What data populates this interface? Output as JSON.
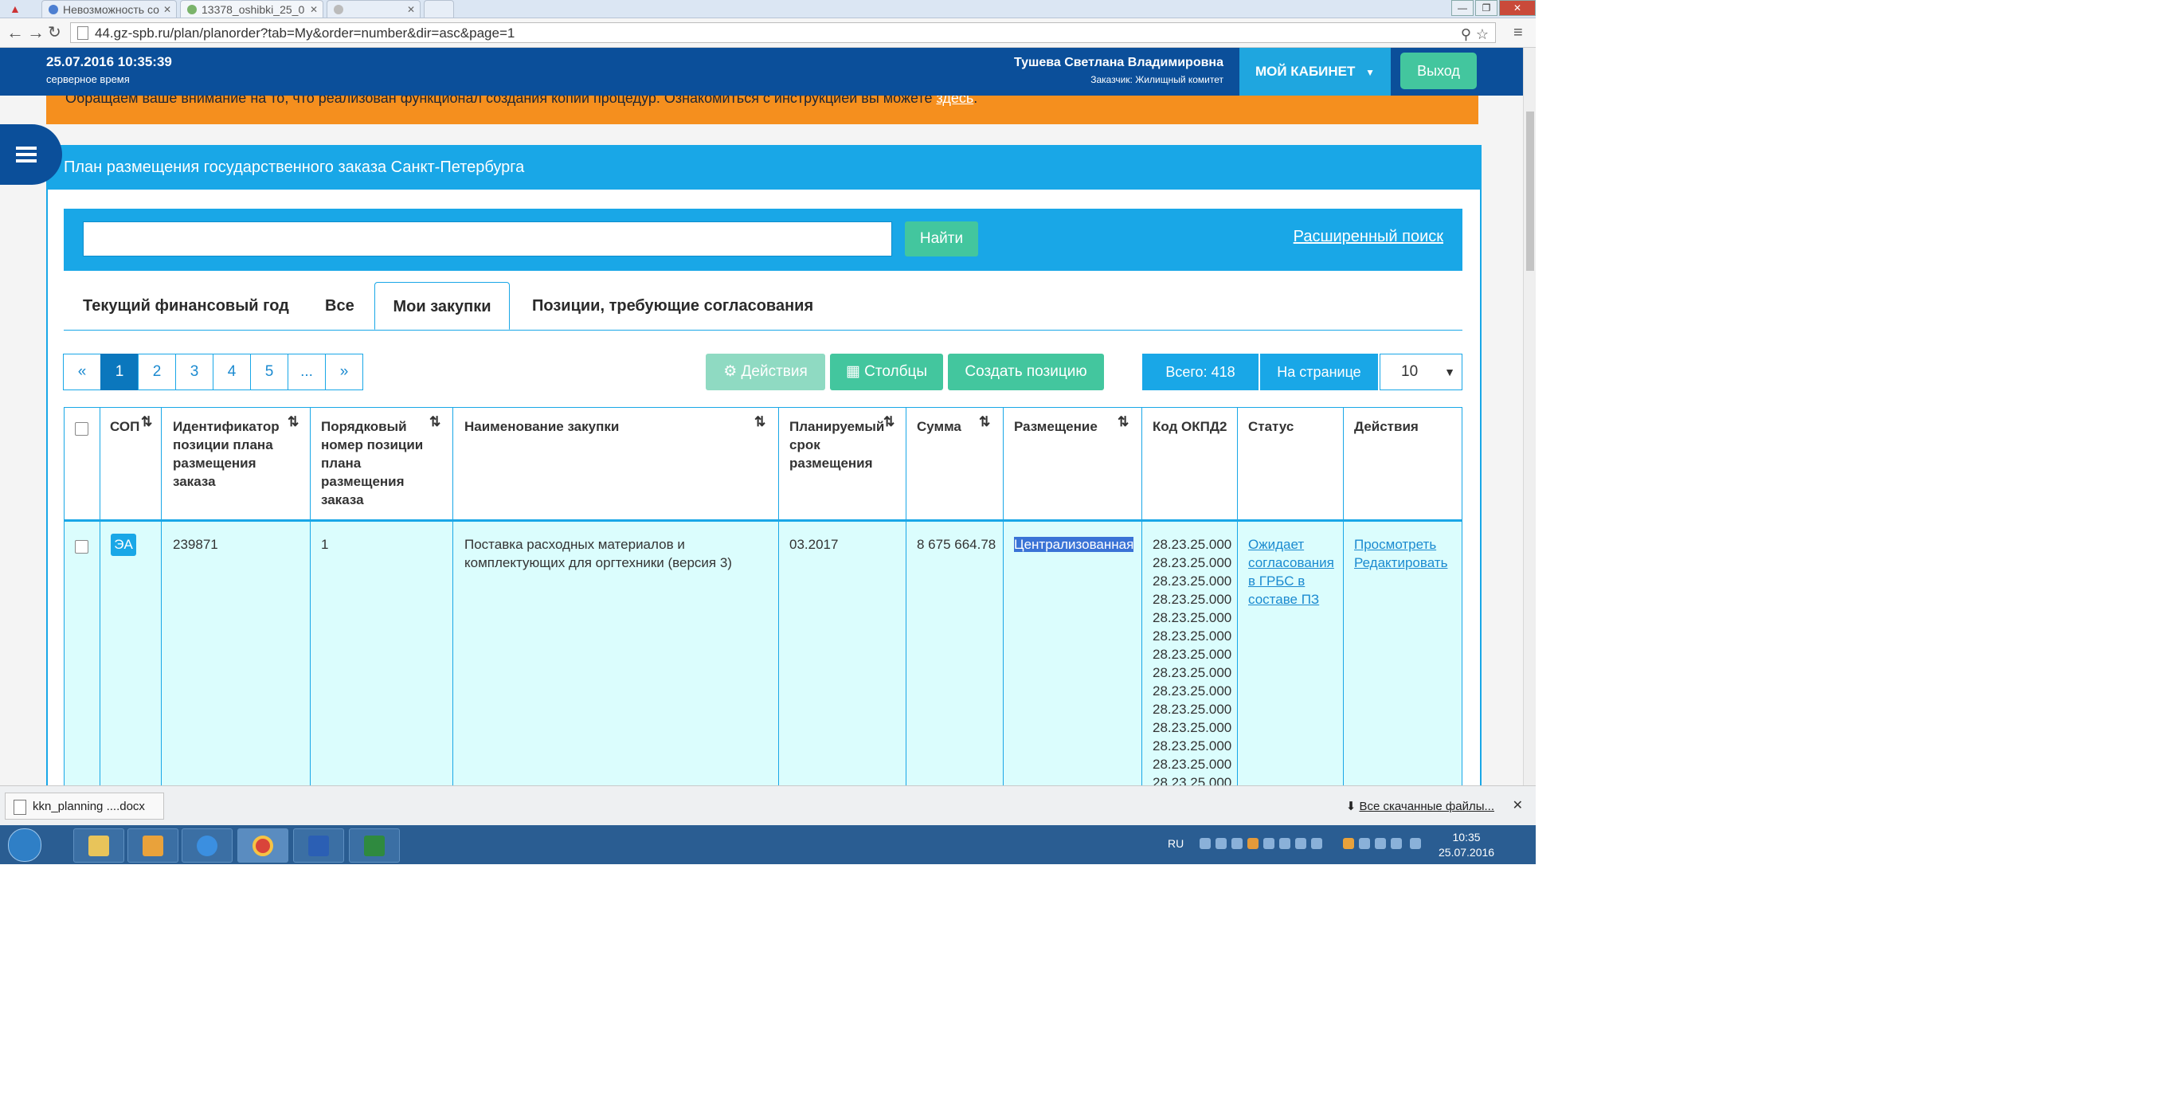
{
  "browser": {
    "tabs": [
      {
        "label": "Невозможность со"
      },
      {
        "label": "13378_oshibki_25_0"
      },
      {
        "label": ""
      }
    ],
    "url": "44.gz-spb.ru/plan/planorder?tab=My&order=number&dir=asc&page=1"
  },
  "header": {
    "server_time": "25.07.2016 10:35:39",
    "server_time_label": "серверное время",
    "user_name": "Тушева Светлана Владимировна",
    "customer": "Заказчик: Жилищный комитет",
    "cabinet_label": "МОЙ КАБИНЕТ",
    "logout_label": "Выход"
  },
  "notice": {
    "text": "Обращаем ваше внимание на то, что реализован функционал создания копии процедур. Ознакомиться с инструкцией вы можете ",
    "link": "здесь",
    "tail": "."
  },
  "panel": {
    "title": "План размещения государственного заказа Санкт-Петербурга"
  },
  "search": {
    "value": "",
    "button": "Найти",
    "advanced": "Расширенный поиск"
  },
  "tabs": [
    {
      "label": "Текущий финансовый год"
    },
    {
      "label": "Все"
    },
    {
      "label": "Мои закупки"
    },
    {
      "label": "Позиции, требующие согласования"
    }
  ],
  "pager": [
    "«",
    "1",
    "2",
    "3",
    "4",
    "5",
    "...",
    "»"
  ],
  "toolbar": {
    "actions": "Действия",
    "columns": "Столбцы",
    "create": "Создать позицию",
    "total": "Всего: 418",
    "per_page_label": "На странице",
    "per_page_value": "10"
  },
  "table": {
    "headers": {
      "sop": "СОП",
      "id": "Идентификатор позиции плана размещения заказа",
      "order_num": "Порядковый номер позиции плана размещения заказа",
      "name": "Наименование закупки",
      "term": "Планируемый срок размещения",
      "sum": "Сумма",
      "placement": "Размещение",
      "okpd": "Код ОКПД2",
      "status": "Статус",
      "actions": "Действия"
    },
    "rows": [
      {
        "sop": "ЭА",
        "id": "239871",
        "order_num": "1",
        "name": "Поставка расходных материалов и комплектующих для оргтехники (версия 3)",
        "term": "03.2017",
        "sum": "8 675 664.78",
        "placement": "Централизованная",
        "okpd": [
          "28.23.25.000",
          "28.23.25.000",
          "28.23.25.000",
          "28.23.25.000",
          "28.23.25.000",
          "28.23.25.000",
          "28.23.25.000",
          "28.23.25.000",
          "28.23.25.000",
          "28.23.25.000",
          "28.23.25.000",
          "28.23.25.000",
          "28.23.25.000",
          "28.23.25.000"
        ],
        "status": "Ожидает согласования в ГРБС в составе ПЗ",
        "view": "Просмотреть",
        "edit": "Редактировать"
      }
    ]
  },
  "downloads": {
    "file": "kkn_planning ....docx",
    "all": "Все скачанные файлы..."
  },
  "taskbar": {
    "lang": "RU",
    "time": "10:35",
    "date": "25.07.2016"
  }
}
